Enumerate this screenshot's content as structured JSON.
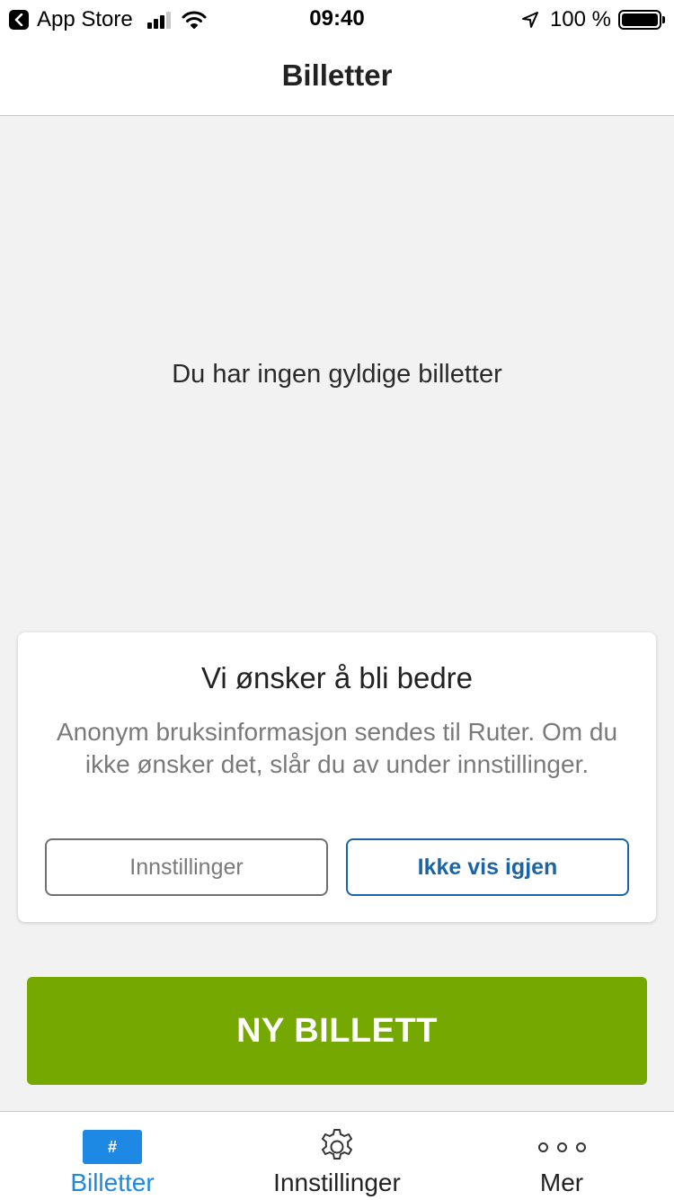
{
  "status_bar": {
    "back_app": "App Store",
    "time": "09:40",
    "battery": "100 %"
  },
  "header": {
    "title": "Billetter"
  },
  "main": {
    "empty_message": "Du har ingen gyldige billetter"
  },
  "feedback_card": {
    "title": "Vi ønsker å bli bedre",
    "body": "Anonym bruksinformasjon sendes til Ruter. Om du ikke ønsker det, slår du av under innstillinger.",
    "settings_button": "Innstillinger",
    "dismiss_button": "Ikke vis igjen"
  },
  "primary_action": {
    "label": "NY BILLETT"
  },
  "tab_bar": {
    "tabs": [
      {
        "label": "Billetter",
        "icon": "ticket-icon",
        "icon_glyph": "#",
        "active": true
      },
      {
        "label": "Innstillinger",
        "icon": "gear-icon",
        "active": false
      },
      {
        "label": "Mer",
        "icon": "more-icon",
        "active": false
      }
    ]
  },
  "colors": {
    "accent_blue": "#1e88e5",
    "link_blue": "#1b64a8",
    "primary_green": "#75a800",
    "background": "#f2f2f2"
  }
}
